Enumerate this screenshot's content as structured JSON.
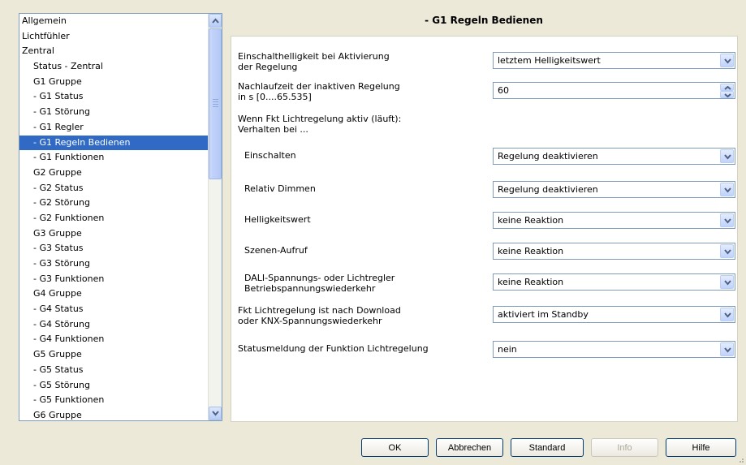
{
  "tree": {
    "items": [
      {
        "label": "Allgemein",
        "level": 0
      },
      {
        "label": "Lichtfühler",
        "level": 0
      },
      {
        "label": "Zentral",
        "level": 0
      },
      {
        "label": "Status - Zentral",
        "level": 1
      },
      {
        "label": "G1 Gruppe",
        "level": 1
      },
      {
        "label": "- G1 Status",
        "level": 1
      },
      {
        "label": "- G1 Störung",
        "level": 1
      },
      {
        "label": "- G1 Regler",
        "level": 1
      },
      {
        "label": "- G1 Regeln Bedienen",
        "level": 1,
        "selected": true
      },
      {
        "label": "- G1 Funktionen",
        "level": 1
      },
      {
        "label": "G2 Gruppe",
        "level": 1
      },
      {
        "label": "- G2 Status",
        "level": 1
      },
      {
        "label": "- G2 Störung",
        "level": 1
      },
      {
        "label": "- G2 Funktionen",
        "level": 1
      },
      {
        "label": "G3 Gruppe",
        "level": 1
      },
      {
        "label": "- G3 Status",
        "level": 1
      },
      {
        "label": "- G3 Störung",
        "level": 1
      },
      {
        "label": "- G3 Funktionen",
        "level": 1
      },
      {
        "label": "G4 Gruppe",
        "level": 1
      },
      {
        "label": "- G4 Status",
        "level": 1
      },
      {
        "label": "- G4 Störung",
        "level": 1
      },
      {
        "label": "- G4 Funktionen",
        "level": 1
      },
      {
        "label": "G5 Gruppe",
        "level": 1
      },
      {
        "label": "- G5 Status",
        "level": 1
      },
      {
        "label": "- G5 Störung",
        "level": 1
      },
      {
        "label": "- G5 Funktionen",
        "level": 1
      },
      {
        "label": "G6 Gruppe",
        "level": 1
      }
    ]
  },
  "panel": {
    "title": "- G1 Regeln Bedienen",
    "fields": [
      {
        "label1": "Einschalthelligkeit bei Aktivierung",
        "label2": "der Regelung",
        "control": "select",
        "value": "letztem Helligkeitswert"
      },
      {
        "label1": "Nachlaufzeit der inaktiven Regelung",
        "label2": "in s [0....65.535]",
        "control": "spin",
        "value": "60"
      },
      {
        "label1": "Wenn Fkt Lichtregelung aktiv (läuft):",
        "label2": "Verhalten bei ...",
        "control": "none",
        "value": ""
      },
      {
        "label1": "Einschalten",
        "label2": "",
        "control": "select",
        "value": "Regelung deaktivieren"
      },
      {
        "label1": "Relativ Dimmen",
        "label2": "",
        "control": "select",
        "value": "Regelung deaktivieren"
      },
      {
        "label1": "Helligkeitswert",
        "label2": "",
        "control": "select",
        "value": "keine Reaktion"
      },
      {
        "label1": "Szenen-Aufruf",
        "label2": "",
        "control": "select",
        "value": "keine Reaktion"
      },
      {
        "label1": "DALI-Spannungs- oder Lichtregler",
        "label2": "Betriebspannungswiederkehr",
        "control": "select",
        "value": "keine Reaktion"
      },
      {
        "label1": "Fkt Lichtregelung ist nach Download",
        "label2": "oder KNX-Spannungswiederkehr",
        "control": "select",
        "value": "aktiviert im Standby"
      },
      {
        "label1": "Statusmeldung der Funktion Lichtregelung",
        "label2": "",
        "control": "select",
        "value": "nein"
      }
    ]
  },
  "buttons": {
    "ok": "OK",
    "cancel": "Abbrechen",
    "standard": "Standard",
    "info": "Info",
    "help": "Hilfe"
  },
  "colors": {
    "selection": "#316ac5",
    "dialog_bg": "#ece9d8",
    "button_border": "#003c74"
  }
}
